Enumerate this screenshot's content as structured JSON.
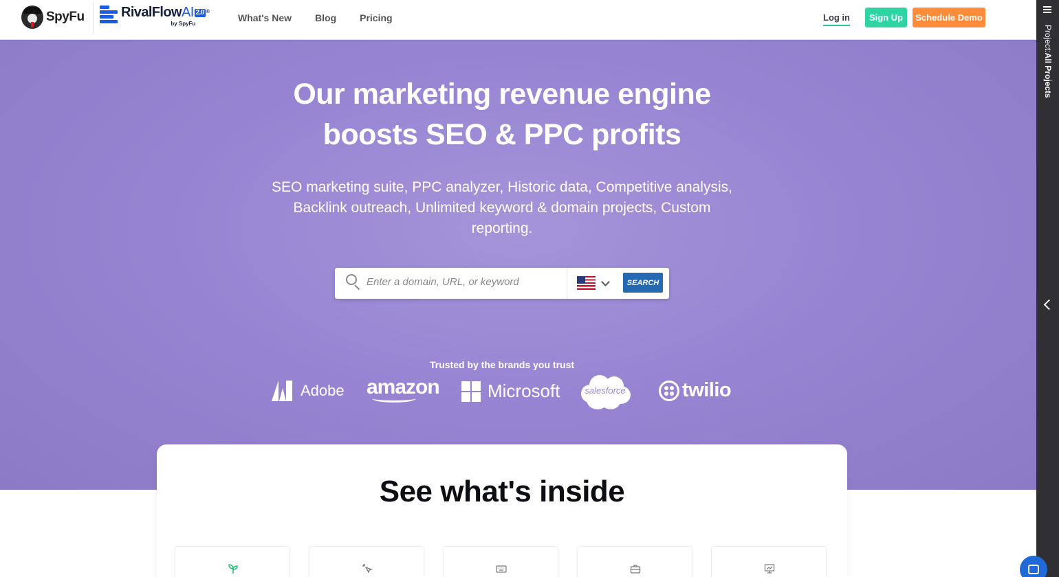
{
  "header": {
    "spyfu_name": "SpyFu",
    "rival_name": "RivalFlow",
    "rival_ai": "AI",
    "rival_version": "2.0",
    "rival_reg": "®",
    "rival_by": "by SpyFu",
    "nav": [
      "What's New",
      "Blog",
      "Pricing"
    ],
    "login": "Log in",
    "signup": "Sign Up",
    "schedule_demo": "Schedule Demo"
  },
  "hero": {
    "title_line1": "Our marketing revenue engine",
    "title_line2": "boosts SEO & PPC profits",
    "subtitle": "SEO marketing suite, PPC analyzer, Historic data, Competitive analysis, Backlink outreach, Unlimited keyword & domain projects, Custom reporting.",
    "search_placeholder": "Enter a domain, URL, or keyword",
    "search_button": "SEARCH",
    "trusted_label": "Trusted by the brands you trust",
    "brands": [
      "Adobe",
      "amazon",
      "Microsoft",
      "salesforce",
      "twilio"
    ]
  },
  "inside": {
    "title": "See what's inside",
    "tile_icons": [
      "sprout-icon",
      "cursor-click-icon",
      "keyboard-icon",
      "briefcase-icon",
      "presentation-chart-icon"
    ]
  },
  "side_panel": {
    "project_label": "Project:",
    "project_value": "All Projects"
  },
  "colors": {
    "hero_bg": "#9785d3",
    "signup": "#2fd4a3",
    "demo": "#ff8c3a",
    "search_button": "#2469b2",
    "side_panel": "#2f2f34",
    "brand_blue": "#1a5ce6"
  }
}
